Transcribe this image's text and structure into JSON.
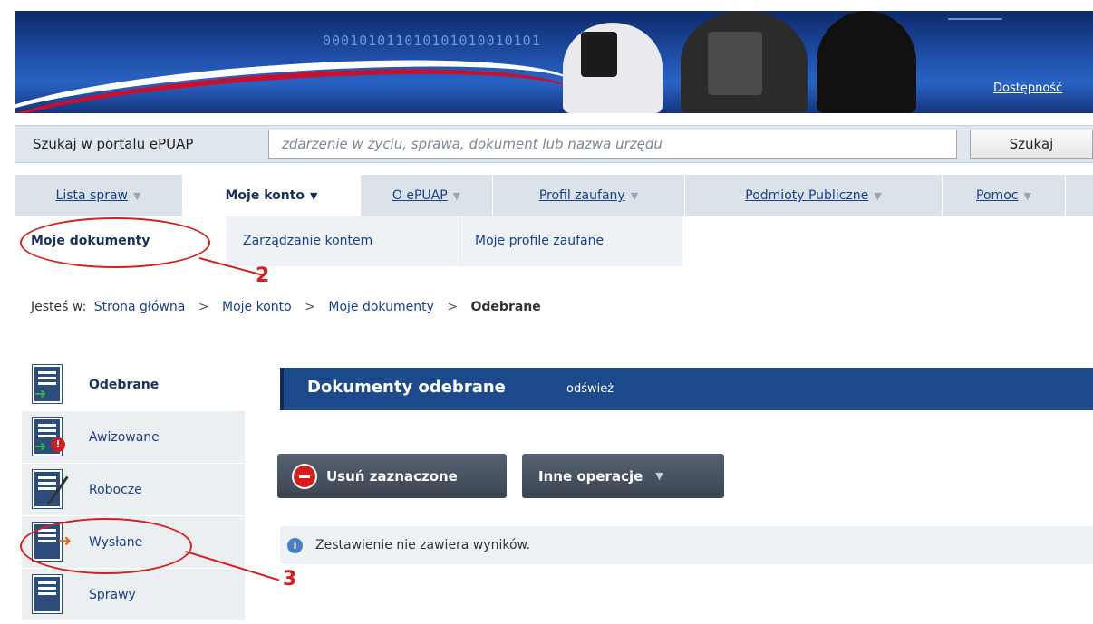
{
  "banner": {
    "binary_text": "000101011010101010010101",
    "accessibility_link": "Dostępność"
  },
  "search": {
    "label": "Szukaj w portalu ePUAP",
    "placeholder": "zdarzenie w życiu, sprawa, dokument lub nazwa urzędu",
    "button": "Szukaj"
  },
  "nav": {
    "tabs": [
      {
        "label": "Lista spraw"
      },
      {
        "label": "Moje konto"
      },
      {
        "label": "O ePUAP"
      },
      {
        "label": "Profil zaufany"
      },
      {
        "label": "Podmioty Publiczne"
      },
      {
        "label": "Pomoc"
      }
    ],
    "arrow": "▼"
  },
  "subnav": {
    "tabs": [
      {
        "label": "Moje dokumenty"
      },
      {
        "label": "Zarządzanie kontem"
      },
      {
        "label": "Moje profile zaufane"
      }
    ]
  },
  "breadcrumb": {
    "prefix": "Jesteś w:",
    "items": [
      "Strona główna",
      "Moje konto",
      "Moje dokumenty"
    ],
    "current": "Odebrane",
    "sep": ">"
  },
  "sidebar": {
    "items": [
      {
        "label": "Odebrane",
        "icon": "inbox-document-icon"
      },
      {
        "label": "Awizowane",
        "icon": "notified-document-icon"
      },
      {
        "label": "Robocze",
        "icon": "draft-document-icon"
      },
      {
        "label": "Wysłane",
        "icon": "sent-document-icon"
      },
      {
        "label": "Sprawy",
        "icon": "cases-document-icon"
      }
    ]
  },
  "panel": {
    "title": "Dokumenty odebrane",
    "refresh": "odśwież"
  },
  "buttons": {
    "delete": "Usuń zaznaczone",
    "other": "Inne operacje",
    "other_arrow": "▼"
  },
  "info": {
    "icon": "i",
    "message": "Zestawienie nie zawiera wyników."
  },
  "annotations": {
    "two": "2",
    "three": "3"
  },
  "colors": {
    "accent": "#1d4a8c",
    "annotation": "#d81e1e"
  }
}
